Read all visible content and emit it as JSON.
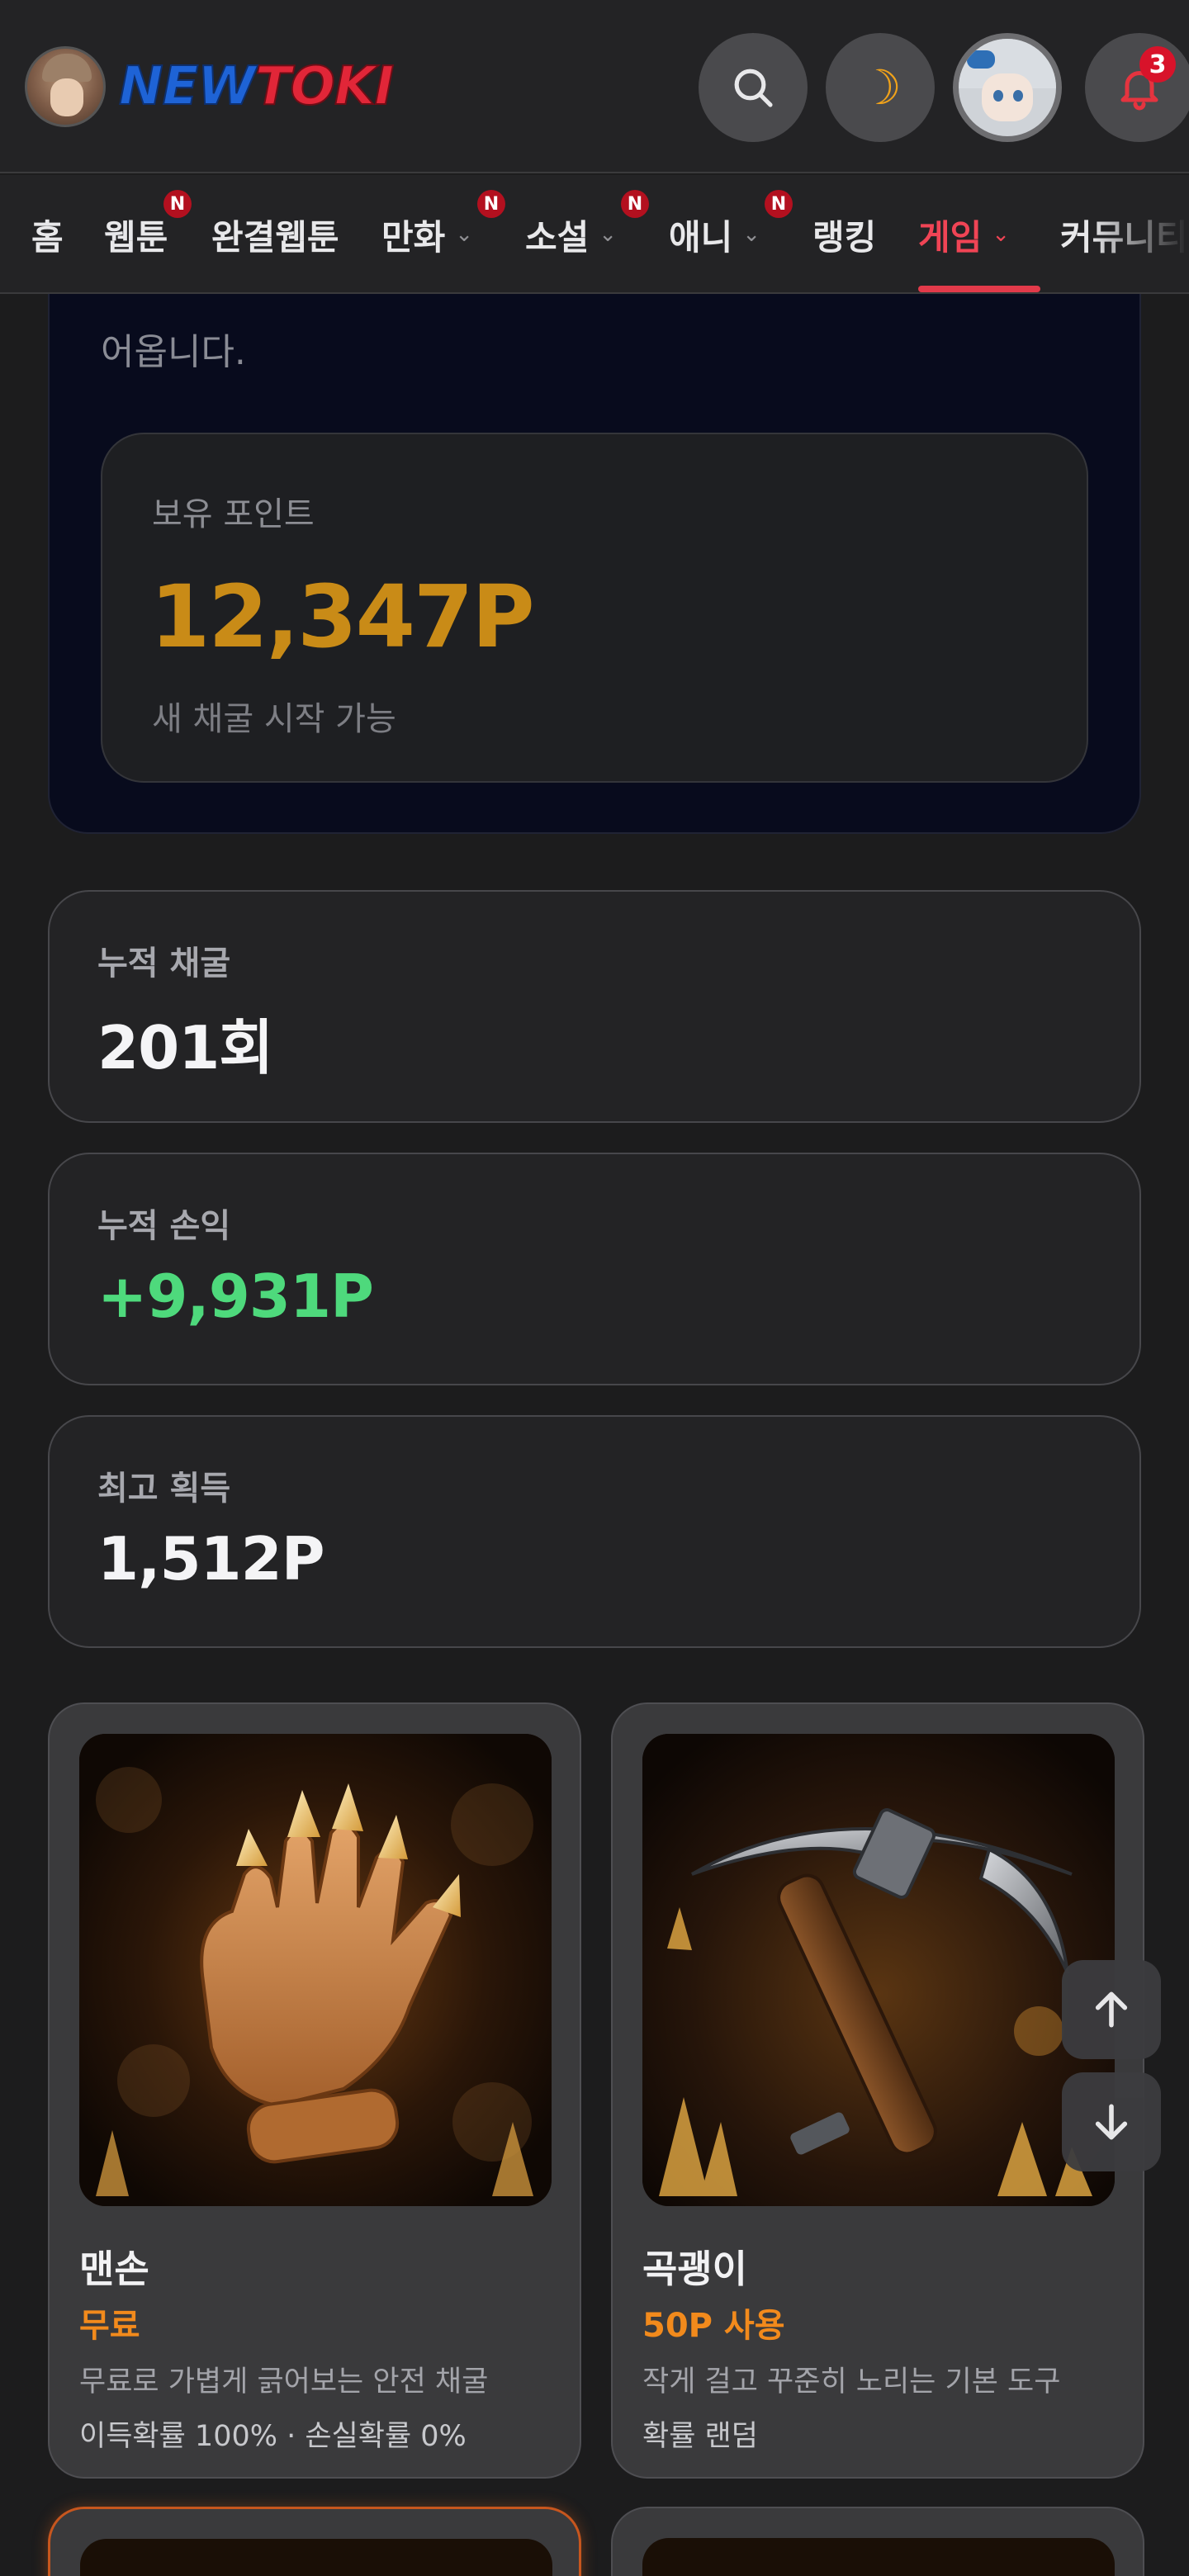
{
  "header": {
    "logo_new": "NEW",
    "logo_toki": "TOKI",
    "notification_count": "3",
    "icons": [
      "search-icon",
      "moon-icon",
      "profile-avatar",
      "bell-icon"
    ],
    "colors": {
      "logo_new": "#1e63d6",
      "logo_toki": "#e12638",
      "bell": "#e5343f",
      "moon": "#f0a21a"
    }
  },
  "nav": {
    "items": [
      {
        "label": "홈",
        "new": false,
        "dropdown": false
      },
      {
        "label": "웹툰",
        "new": true,
        "dropdown": false
      },
      {
        "label": "완결웹툰",
        "new": false,
        "dropdown": false
      },
      {
        "label": "만화",
        "new": true,
        "dropdown": true
      },
      {
        "label": "소설",
        "new": true,
        "dropdown": true
      },
      {
        "label": "애니",
        "new": true,
        "dropdown": true
      },
      {
        "label": "랭킹",
        "new": false,
        "dropdown": false
      },
      {
        "label": "게임",
        "new": false,
        "dropdown": true,
        "active": true
      },
      {
        "label": "커뮤니티",
        "new": false,
        "dropdown": false
      }
    ],
    "new_badge": "N",
    "active_color": "#f04455"
  },
  "hero": {
    "desc_tail": "어옵니다.",
    "points_label": "보유 포인트",
    "points_value": "12,347P",
    "points_sub": "새 채굴 시작 가능",
    "points_color": "#c98b17"
  },
  "stats": [
    {
      "label": "누적 채굴",
      "value": "201회"
    },
    {
      "label": "누적 손익",
      "value": "+9,931P",
      "color": "#4ed97c"
    },
    {
      "label": "최고 획득",
      "value": "1,512P"
    }
  ],
  "tools": [
    {
      "name": "맨손",
      "cost": "무료",
      "desc": "무료로 가볍게 긁어보는 안전 채굴",
      "odds": "이득확률 100% · 손실확률 0%",
      "icon": "crystal-glove-image"
    },
    {
      "name": "곡괭이",
      "cost": "50P 사용",
      "desc": "작게 걸고 꾸준히 노리는 기본 도구",
      "odds": "확률 랜덤",
      "icon": "pickaxe-image"
    }
  ],
  "scroll": {
    "up_icon": "arrow-up-icon",
    "down_icon": "arrow-down-icon"
  }
}
